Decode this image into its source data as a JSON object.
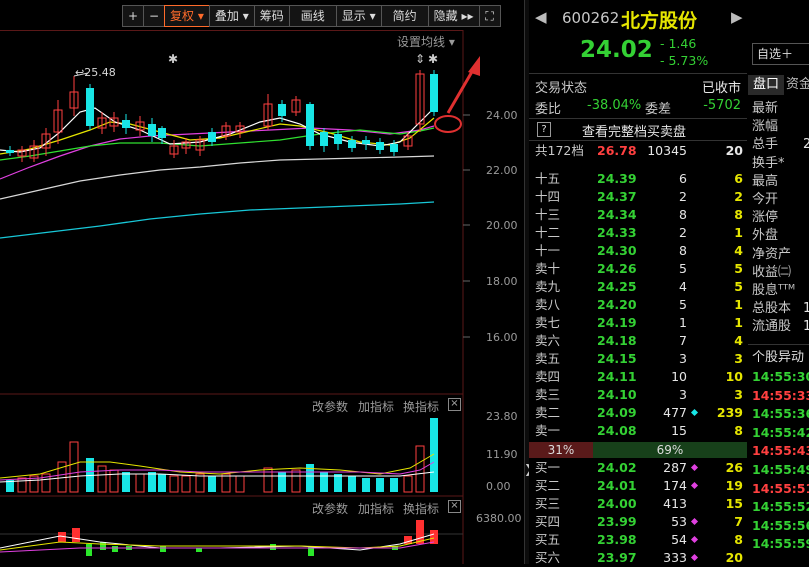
{
  "toolbar": {
    "zoom_in": "+",
    "zoom_out": "−",
    "adjust": "复权",
    "overlay": "叠加",
    "chips": "筹码",
    "draw": "画线",
    "display": "显示",
    "simple": "简约",
    "hide": "隐藏"
  },
  "chart": {
    "ma_settings": "设置均线",
    "price_ticks": [
      "24.00",
      "22.00",
      "20.00",
      "18.00",
      "16.00"
    ],
    "high_label": "25.48",
    "vol_ticks": [
      "23.80",
      "11.90",
      "0.00"
    ],
    "macd_tick": "6380.00",
    "indicator_links": {
      "params": "改参数",
      "add": "加指标",
      "switch": "换指标"
    }
  },
  "quote": {
    "code": "600262",
    "name": "北方股份",
    "price": "24.02",
    "change": "- 1.46",
    "change_pct": "- 5.73%",
    "watch_button": "自选",
    "status_label": "交易状态",
    "status_value": "已收市",
    "weibi_label": "委比",
    "weibi_value": "-38.04%",
    "weicha_label": "委差",
    "weicha_value": "-5702",
    "full_book_link": "查看完整档买卖盘",
    "levels_label": "共172档",
    "levels_price": "26.78",
    "levels_vol": "10345",
    "levels_count": "20",
    "asks": [
      {
        "label": "十五",
        "price": "24.39",
        "vol": "6",
        "chg": "6"
      },
      {
        "label": "十四",
        "price": "24.37",
        "vol": "2",
        "chg": "2"
      },
      {
        "label": "十三",
        "price": "24.34",
        "vol": "8",
        "chg": "8"
      },
      {
        "label": "十二",
        "price": "24.33",
        "vol": "2",
        "chg": "1"
      },
      {
        "label": "十一",
        "price": "24.30",
        "vol": "8",
        "chg": "4"
      },
      {
        "label": "卖十",
        "price": "24.26",
        "vol": "5",
        "chg": "5"
      },
      {
        "label": "卖九",
        "price": "24.25",
        "vol": "4",
        "chg": "5"
      },
      {
        "label": "卖八",
        "price": "24.20",
        "vol": "5",
        "chg": "1"
      },
      {
        "label": "卖七",
        "price": "24.19",
        "vol": "1",
        "chg": "1"
      },
      {
        "label": "卖六",
        "price": "24.18",
        "vol": "7",
        "chg": "4"
      },
      {
        "label": "卖五",
        "price": "24.15",
        "vol": "3",
        "chg": "3"
      },
      {
        "label": "卖四",
        "price": "24.11",
        "vol": "10",
        "chg": "10"
      },
      {
        "label": "卖三",
        "price": "24.10",
        "vol": "3",
        "chg": "3"
      },
      {
        "label": "卖二",
        "price": "24.09",
        "vol": "477",
        "chg": "239"
      },
      {
        "label": "卖一",
        "price": "24.08",
        "vol": "15",
        "chg": "8"
      }
    ],
    "ratio_sell": "31%",
    "ratio_buy": "69%",
    "bids": [
      {
        "label": "买一",
        "price": "24.02",
        "vol": "287",
        "chg": "26"
      },
      {
        "label": "买二",
        "price": "24.01",
        "vol": "174",
        "chg": "19"
      },
      {
        "label": "买三",
        "price": "24.00",
        "vol": "413",
        "chg": "15"
      },
      {
        "label": "买四",
        "price": "23.99",
        "vol": "53",
        "chg": "7"
      },
      {
        "label": "买五",
        "price": "23.98",
        "vol": "54",
        "chg": "8"
      },
      {
        "label": "买六",
        "price": "23.97",
        "vol": "333",
        "chg": "20"
      }
    ]
  },
  "info": {
    "tab_pankou": "盘口",
    "tab_zijin": "资金",
    "rows": [
      "最新",
      "涨幅",
      "总手",
      "换手*",
      "最高",
      "今开",
      "涨停",
      "外盘",
      "净资产",
      "收益㈡",
      "股息ᵀᵀᴹ",
      "总股本",
      "流通股"
    ],
    "row_values": [
      "",
      "",
      "2",
      "",
      "",
      "",
      "",
      "",
      "",
      "",
      "",
      "1",
      "1"
    ],
    "anomaly_title": "个股异动",
    "times": [
      "14:55:30",
      "14:55:33",
      "14:55:36",
      "14:55:42",
      "14:55:43",
      "14:55:49",
      "14:55:51",
      "14:55:52",
      "14:55:56",
      "14:55:59"
    ],
    "time_colors": [
      "green",
      "red",
      "green",
      "green",
      "red",
      "green",
      "red",
      "green",
      "green",
      "green"
    ]
  }
}
